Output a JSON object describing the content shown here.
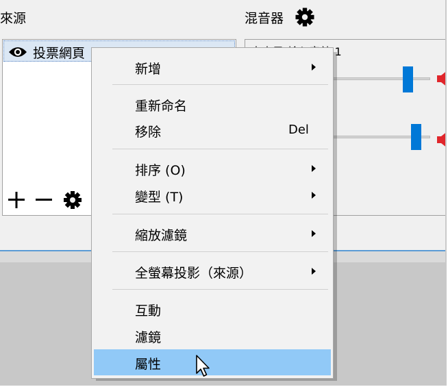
{
  "sources": {
    "title": "來源",
    "items": [
      {
        "label": "投票網頁",
        "visible": true
      }
    ],
    "toolbar": [
      "add-icon",
      "remove-icon",
      "gear-icon"
    ]
  },
  "mixer": {
    "title": "混音器",
    "channel_label": "麥克風/輸入音效 1",
    "sliders": [
      0.78,
      0.86
    ],
    "accent": "#0078d7",
    "speaker_color": "#e0262b"
  },
  "context_menu": {
    "items": [
      {
        "label": "新增",
        "submenu": true
      },
      {
        "label": "重新命名"
      },
      {
        "label": "移除",
        "shortcut": "Del"
      },
      {
        "label": "排序 (O)",
        "submenu": true
      },
      {
        "label": "變型 (T)",
        "submenu": true
      },
      {
        "label": "縮放濾鏡",
        "submenu": true
      },
      {
        "label": "全螢幕投影（來源）",
        "submenu": true
      },
      {
        "label": "互動"
      },
      {
        "label": "濾鏡"
      },
      {
        "label": "屬性",
        "highlighted": true
      }
    ],
    "highlight_color": "#91c9f7"
  }
}
